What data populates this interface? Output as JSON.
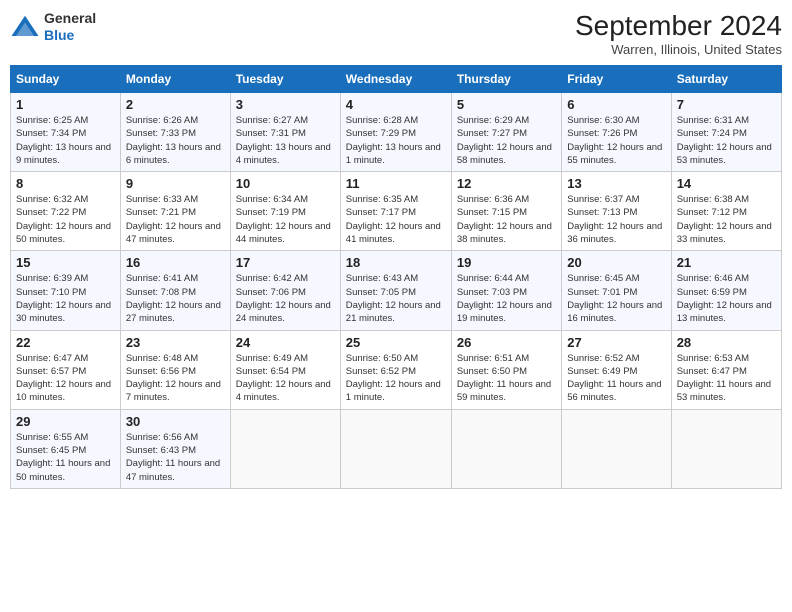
{
  "header": {
    "logo_line1": "General",
    "logo_line2": "Blue",
    "month_title": "September 2024",
    "location": "Warren, Illinois, United States"
  },
  "days_of_week": [
    "Sunday",
    "Monday",
    "Tuesday",
    "Wednesday",
    "Thursday",
    "Friday",
    "Saturday"
  ],
  "weeks": [
    [
      {
        "day": "1",
        "sunrise": "6:25 AM",
        "sunset": "7:34 PM",
        "daylight": "13 hours and 9 minutes."
      },
      {
        "day": "2",
        "sunrise": "6:26 AM",
        "sunset": "7:33 PM",
        "daylight": "13 hours and 6 minutes."
      },
      {
        "day": "3",
        "sunrise": "6:27 AM",
        "sunset": "7:31 PM",
        "daylight": "13 hours and 4 minutes."
      },
      {
        "day": "4",
        "sunrise": "6:28 AM",
        "sunset": "7:29 PM",
        "daylight": "13 hours and 1 minute."
      },
      {
        "day": "5",
        "sunrise": "6:29 AM",
        "sunset": "7:27 PM",
        "daylight": "12 hours and 58 minutes."
      },
      {
        "day": "6",
        "sunrise": "6:30 AM",
        "sunset": "7:26 PM",
        "daylight": "12 hours and 55 minutes."
      },
      {
        "day": "7",
        "sunrise": "6:31 AM",
        "sunset": "7:24 PM",
        "daylight": "12 hours and 53 minutes."
      }
    ],
    [
      {
        "day": "8",
        "sunrise": "6:32 AM",
        "sunset": "7:22 PM",
        "daylight": "12 hours and 50 minutes."
      },
      {
        "day": "9",
        "sunrise": "6:33 AM",
        "sunset": "7:21 PM",
        "daylight": "12 hours and 47 minutes."
      },
      {
        "day": "10",
        "sunrise": "6:34 AM",
        "sunset": "7:19 PM",
        "daylight": "12 hours and 44 minutes."
      },
      {
        "day": "11",
        "sunrise": "6:35 AM",
        "sunset": "7:17 PM",
        "daylight": "12 hours and 41 minutes."
      },
      {
        "day": "12",
        "sunrise": "6:36 AM",
        "sunset": "7:15 PM",
        "daylight": "12 hours and 38 minutes."
      },
      {
        "day": "13",
        "sunrise": "6:37 AM",
        "sunset": "7:13 PM",
        "daylight": "12 hours and 36 minutes."
      },
      {
        "day": "14",
        "sunrise": "6:38 AM",
        "sunset": "7:12 PM",
        "daylight": "12 hours and 33 minutes."
      }
    ],
    [
      {
        "day": "15",
        "sunrise": "6:39 AM",
        "sunset": "7:10 PM",
        "daylight": "12 hours and 30 minutes."
      },
      {
        "day": "16",
        "sunrise": "6:41 AM",
        "sunset": "7:08 PM",
        "daylight": "12 hours and 27 minutes."
      },
      {
        "day": "17",
        "sunrise": "6:42 AM",
        "sunset": "7:06 PM",
        "daylight": "12 hours and 24 minutes."
      },
      {
        "day": "18",
        "sunrise": "6:43 AM",
        "sunset": "7:05 PM",
        "daylight": "12 hours and 21 minutes."
      },
      {
        "day": "19",
        "sunrise": "6:44 AM",
        "sunset": "7:03 PM",
        "daylight": "12 hours and 19 minutes."
      },
      {
        "day": "20",
        "sunrise": "6:45 AM",
        "sunset": "7:01 PM",
        "daylight": "12 hours and 16 minutes."
      },
      {
        "day": "21",
        "sunrise": "6:46 AM",
        "sunset": "6:59 PM",
        "daylight": "12 hours and 13 minutes."
      }
    ],
    [
      {
        "day": "22",
        "sunrise": "6:47 AM",
        "sunset": "6:57 PM",
        "daylight": "12 hours and 10 minutes."
      },
      {
        "day": "23",
        "sunrise": "6:48 AM",
        "sunset": "6:56 PM",
        "daylight": "12 hours and 7 minutes."
      },
      {
        "day": "24",
        "sunrise": "6:49 AM",
        "sunset": "6:54 PM",
        "daylight": "12 hours and 4 minutes."
      },
      {
        "day": "25",
        "sunrise": "6:50 AM",
        "sunset": "6:52 PM",
        "daylight": "12 hours and 1 minute."
      },
      {
        "day": "26",
        "sunrise": "6:51 AM",
        "sunset": "6:50 PM",
        "daylight": "11 hours and 59 minutes."
      },
      {
        "day": "27",
        "sunrise": "6:52 AM",
        "sunset": "6:49 PM",
        "daylight": "11 hours and 56 minutes."
      },
      {
        "day": "28",
        "sunrise": "6:53 AM",
        "sunset": "6:47 PM",
        "daylight": "11 hours and 53 minutes."
      }
    ],
    [
      {
        "day": "29",
        "sunrise": "6:55 AM",
        "sunset": "6:45 PM",
        "daylight": "11 hours and 50 minutes."
      },
      {
        "day": "30",
        "sunrise": "6:56 AM",
        "sunset": "6:43 PM",
        "daylight": "11 hours and 47 minutes."
      },
      null,
      null,
      null,
      null,
      null
    ]
  ]
}
